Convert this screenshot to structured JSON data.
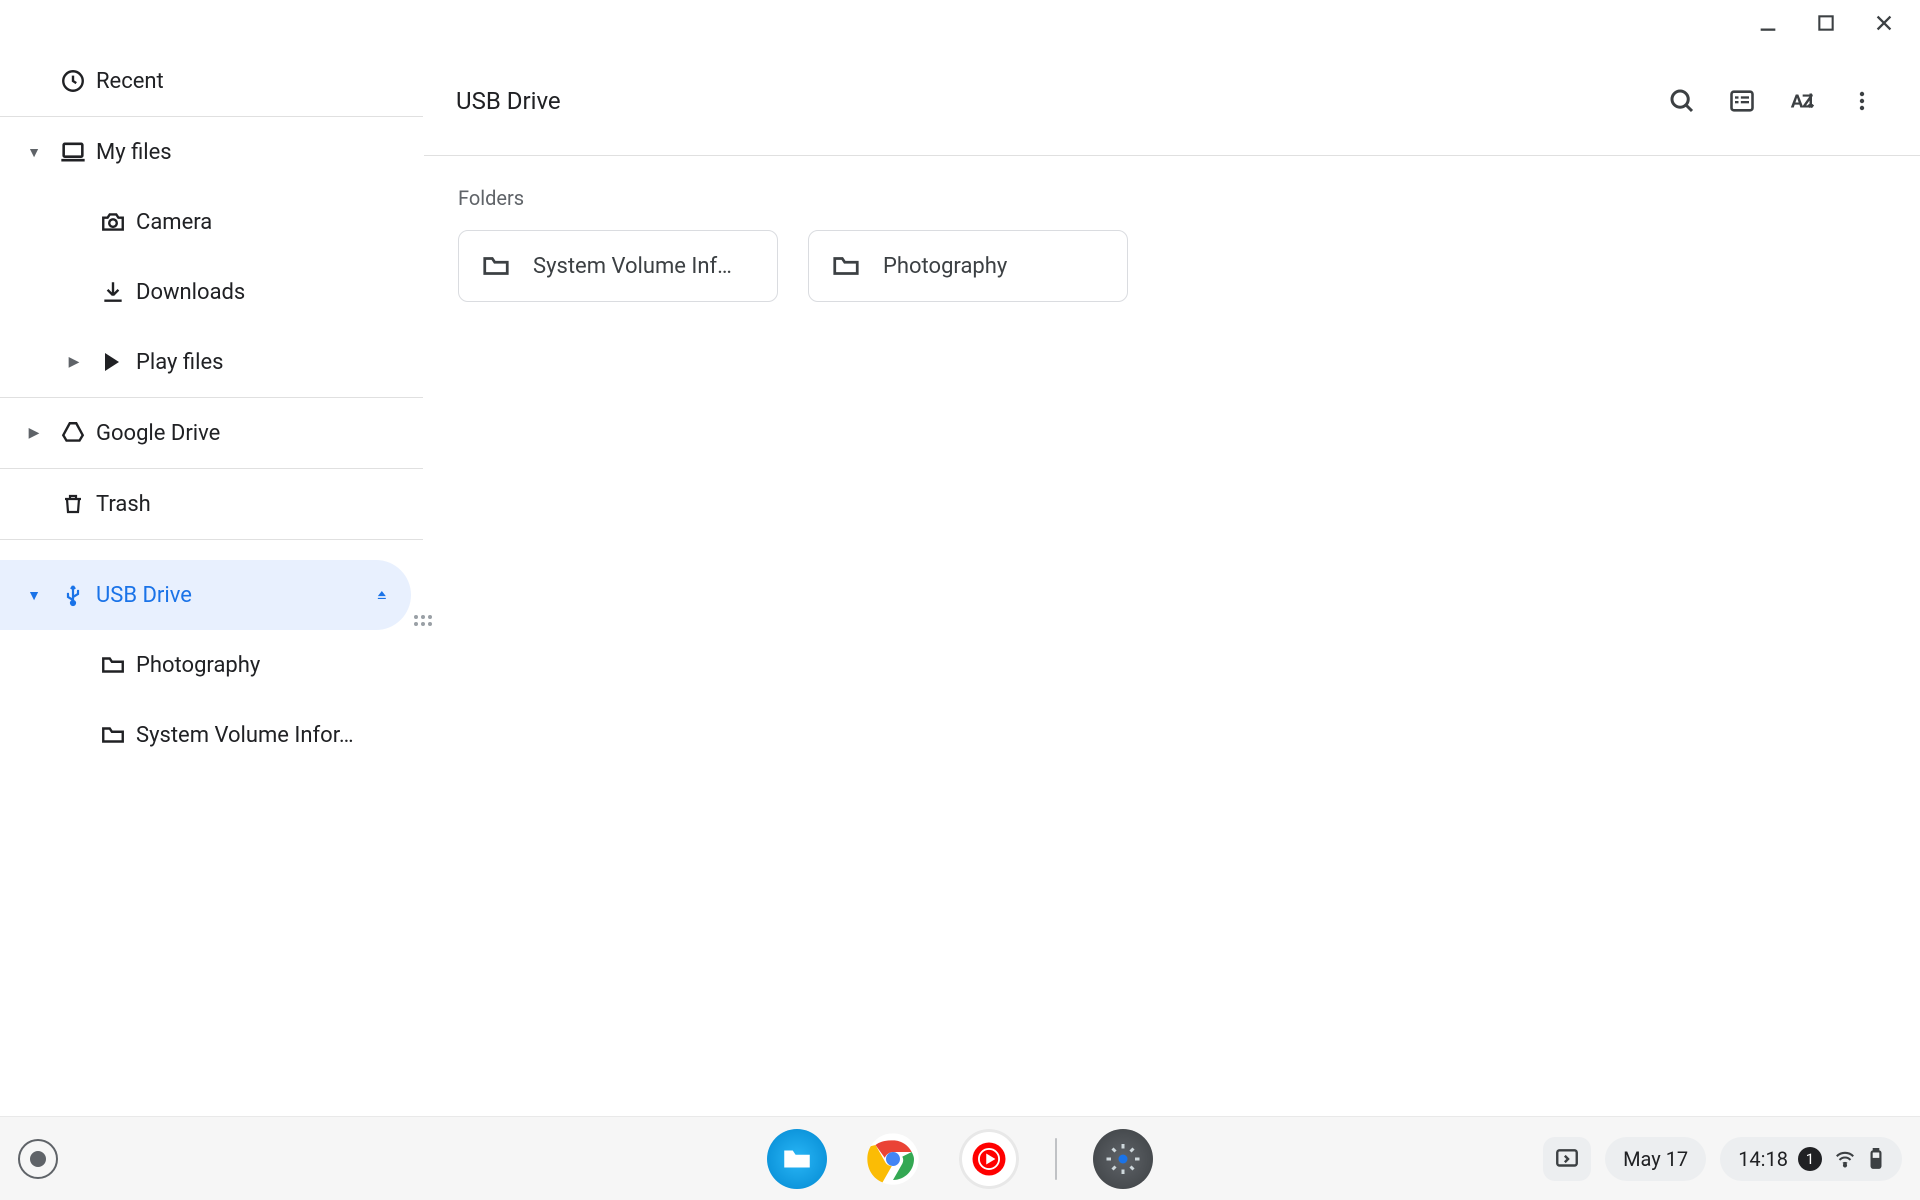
{
  "header": {
    "title": "USB Drive"
  },
  "content": {
    "section_label": "Folders",
    "folders": [
      {
        "name": "System Volume Inf…"
      },
      {
        "name": "Photography"
      }
    ]
  },
  "sidebar": {
    "recent": "Recent",
    "myfiles": "My files",
    "camera": "Camera",
    "downloads": "Downloads",
    "playfiles": "Play files",
    "gdrive": "Google Drive",
    "trash": "Trash",
    "usb": "USB Drive",
    "usb_children": [
      "Photography",
      "System Volume Infor…"
    ]
  },
  "shelf": {
    "date": "May 17",
    "time": "14:18",
    "notif_count": "1"
  }
}
